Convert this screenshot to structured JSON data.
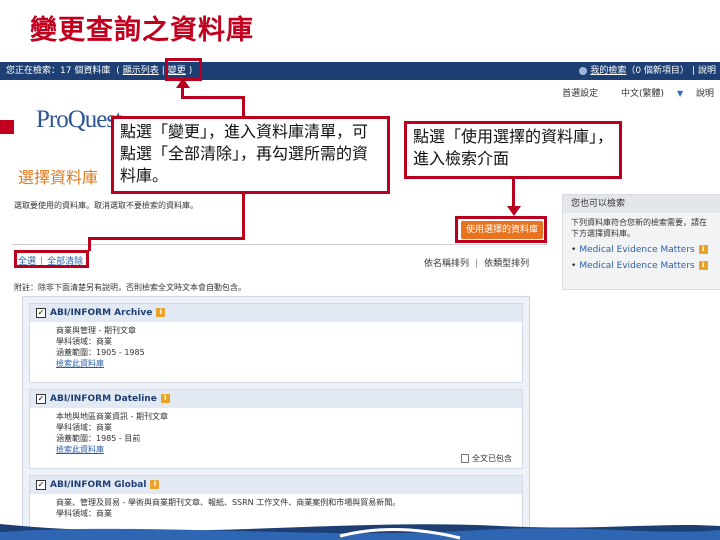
{
  "slide": {
    "title": "變更查詢之資料庫"
  },
  "topbar": {
    "searching_label": "您正在檢索：17 個資料庫",
    "show_list_link": "顯示列表",
    "change_link": "變更",
    "user_label": "我的檢索",
    "new_items": "（0 個新項目）",
    "right_link": "說明"
  },
  "util_links": {
    "preferences": "首選設定",
    "language": "中文(繁體)",
    "help": "說明"
  },
  "logo": {
    "text": "ProQuest"
  },
  "section": {
    "title": "選擇資料庫",
    "instruction": "選取要使用的資料庫。取消選取不要檢索的資料庫。",
    "select_all": "全選",
    "clear_all": "全部清除",
    "sort_by_name": "依名稱排列",
    "sort_by_type": "依類型排列",
    "note": "附註：除非下面清楚另有說明，否則檢索全文時文本會自動包含。"
  },
  "use_button_label": "使用選擇的資料庫",
  "side_panel": {
    "header": "您也可以檢索",
    "description": "下列資料庫符合您新的檢索需要，請在下方選擇資料庫。",
    "items": [
      "Medical Evidence Matters",
      "Medical Evidence Matters"
    ]
  },
  "databases": [
    {
      "name": "ABI/INFORM Archive",
      "checked": "✓",
      "lines": [
        "商業與管理 - 期刊文章",
        "學科領域：商業",
        "涵蓋範圍：1905 - 1985"
      ],
      "link": "檢索此資料庫",
      "fulltext": ""
    },
    {
      "name": "ABI/INFORM Dateline",
      "checked": "✓",
      "lines": [
        "本地與地區商業資訊 - 期刊文章",
        "學科領域：商業",
        "涵蓋範圍：1985 - 目前"
      ],
      "link": "檢索此資料庫",
      "fulltext": "全文已包含"
    },
    {
      "name": "ABI/INFORM Global",
      "checked": "✓",
      "lines": [
        "商業、管理及貿易 - 學術與商業期刊文章、報紙、SSRN 工作文件、商業案例和市場與貿易新聞。",
        "學科領域：商業"
      ],
      "link": "",
      "fulltext": ""
    }
  ],
  "callouts": {
    "left": "點選「變更」，進入資料庫清單，可點選「全部清除」，再勾選所需的資料庫。",
    "right": "點選「使用選擇的資料庫」，進入檢索介面"
  },
  "colors": {
    "accent_red": "#b8001e",
    "title_red": "#c0001e",
    "navy": "#1d3f74",
    "orange": "#e8731f"
  }
}
